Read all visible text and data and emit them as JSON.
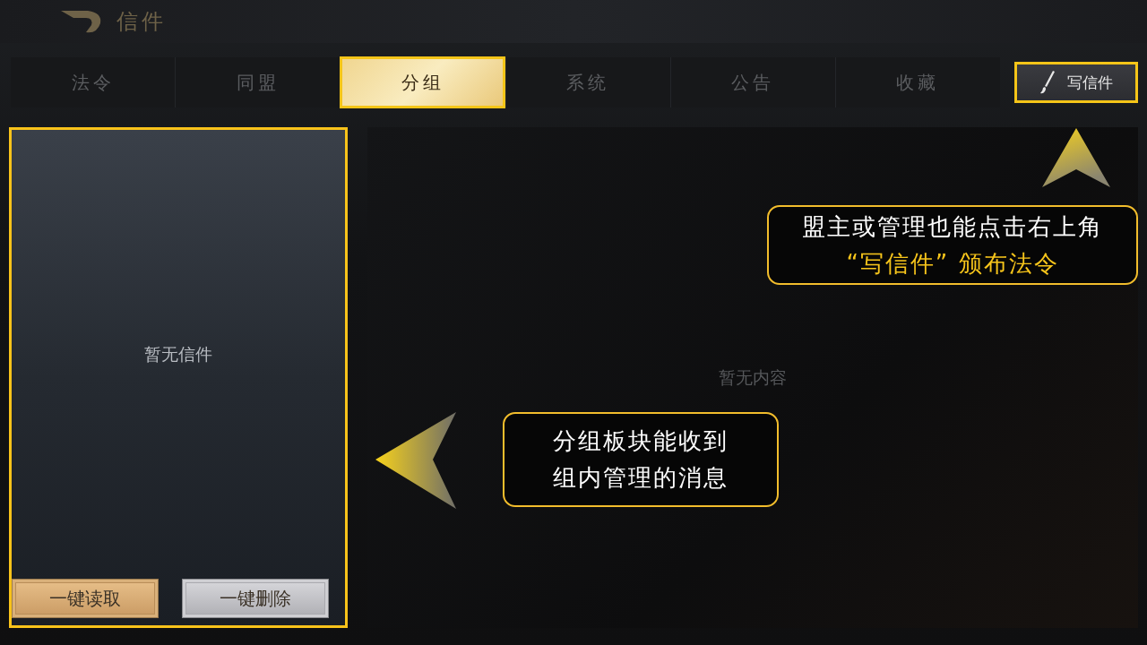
{
  "header": {
    "title": "信件"
  },
  "tabs": [
    {
      "label": "法令",
      "selected": false
    },
    {
      "label": "同盟",
      "selected": false
    },
    {
      "label": "分组",
      "selected": true
    },
    {
      "label": "系统",
      "selected": false
    },
    {
      "label": "公告",
      "selected": false
    },
    {
      "label": "收藏",
      "selected": false
    }
  ],
  "write_button": {
    "label": "写信件",
    "highlighted": true
  },
  "list_panel": {
    "empty_text": "暂无信件",
    "highlighted": true,
    "buttons": [
      {
        "label": "一键读取",
        "kind": "gold"
      },
      {
        "label": "一键删除",
        "kind": "silver"
      }
    ]
  },
  "content_panel": {
    "empty_text": "暂无内容"
  },
  "callouts": [
    {
      "lines": [
        {
          "text": "盟主或管理也能点击右上角",
          "kind": "plain"
        },
        {
          "text": "“写信件” 颁布法令",
          "kind": "highlight"
        }
      ],
      "kind": "up"
    },
    {
      "lines": [
        {
          "text": "分组板块能收到",
          "kind": "plain"
        },
        {
          "text": "组内管理的消息",
          "kind": "plain"
        }
      ],
      "kind": "left"
    }
  ]
}
